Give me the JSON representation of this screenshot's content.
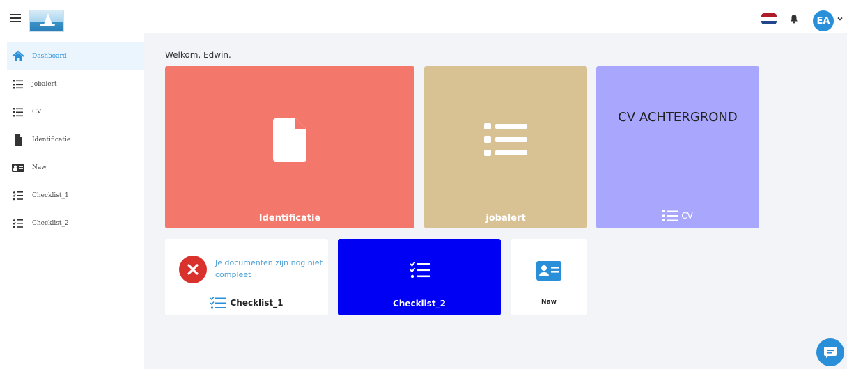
{
  "header": {
    "avatar_initials": "EA",
    "flag_colors": [
      "#ae1c28",
      "#ffffff",
      "#21468b"
    ]
  },
  "sidebar": {
    "items": [
      {
        "label": "Dashboard",
        "icon": "home-icon",
        "active": true
      },
      {
        "label": "jobalert",
        "icon": "list-icon"
      },
      {
        "label": "CV",
        "icon": "list-icon"
      },
      {
        "label": "Identificatie",
        "icon": "file-icon"
      },
      {
        "label": "Naw",
        "icon": "id-card-icon"
      },
      {
        "label": "Checklist_1",
        "icon": "checklist-icon"
      },
      {
        "label": "Checklist_2",
        "icon": "checklist-icon"
      }
    ]
  },
  "main": {
    "welcome": "Welkom, Edwin.",
    "tiles": {
      "identificatie": {
        "label": "Identificatie",
        "color": "#f3786b",
        "icon": "file-icon"
      },
      "jobalert": {
        "label": "jobalert",
        "color": "#d8c192",
        "icon": "list-icon"
      },
      "cv": {
        "title": "CV ACHTERGROND",
        "label": "CV",
        "color": "#a8a6fd",
        "icon": "list-icon"
      },
      "checklist_1": {
        "message": "Je documenten zijn nog niet compleet",
        "label": "Checklist_1",
        "status_icon": "error-x-icon",
        "icon": "checklist-icon"
      },
      "checklist_2": {
        "label": "Checklist_2",
        "color": "#0000f5",
        "icon": "checklist-icon"
      },
      "naw": {
        "label": "Naw",
        "icon": "id-card-icon"
      }
    }
  },
  "colors": {
    "accent": "#2a8fd9",
    "error": "#d9312b",
    "background": "#f3f4f8"
  }
}
